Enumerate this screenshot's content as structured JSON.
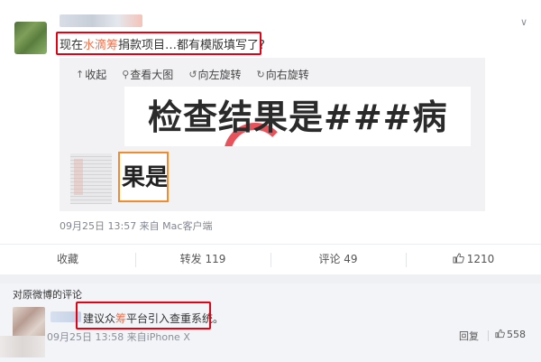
{
  "post": {
    "text_before": "现在",
    "text_highlight": "水滴筹",
    "text_after": "捐款项目…都有模版填写了?",
    "toolbar": [
      {
        "icon": "collapse-icon",
        "glyph": "↑",
        "label": "收起"
      },
      {
        "icon": "zoom-icon",
        "glyph": "⚲",
        "label": "查看大图"
      },
      {
        "icon": "rotate-left-icon",
        "glyph": "↺",
        "label": "向左旋转"
      },
      {
        "icon": "rotate-right-icon",
        "glyph": "↻",
        "label": "向右旋转"
      }
    ],
    "image_text": "检查结果是###病",
    "thumb_text": "果是",
    "meta": "09月25日 13:57  来自 Mac客户端",
    "chevron": "∨"
  },
  "actions": {
    "favorite": "收藏",
    "repost": "转发 119",
    "comment": "评论 49",
    "like_icon": "thumbs-up-icon",
    "like": "1210"
  },
  "comments": {
    "title": "对原微博的评论",
    "items": [
      {
        "text_before": "建议众",
        "text_highlight": "筹",
        "text_after": "平台引入查重系统。",
        "meta": "09月25日 13:58 来自iPhone X",
        "reply": "回复",
        "likes": "558"
      }
    ]
  },
  "colors": {
    "highlight": "#eb7350",
    "annotation_box": "#e60012",
    "thumb_border": "#f08c2e"
  }
}
